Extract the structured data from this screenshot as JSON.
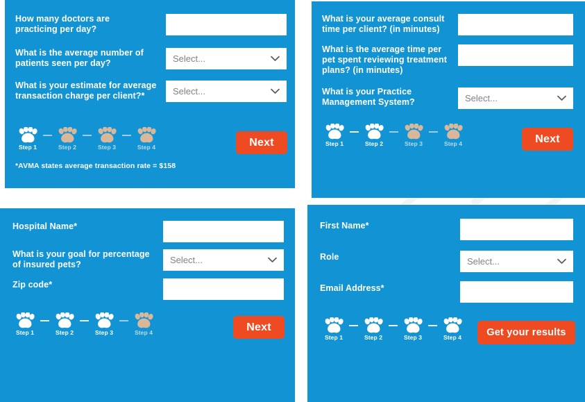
{
  "theme": {
    "panel_blue": "#1193d4",
    "accent_orange": "#ef4b23",
    "label_white": "#ffffff",
    "select_placeholder_grey": "#808285",
    "inactive_step_grey": "#bdd9e8"
  },
  "select_placeholder": "Select...",
  "panels": [
    {
      "id": "step-1-practice-metrics",
      "fields": [
        {
          "name": "doctors-per-day",
          "label": "How many doctors are practicing per day?",
          "control": "text"
        },
        {
          "name": "patients-per-day",
          "label": "What is the average number of patients seen per day?",
          "control": "select",
          "value": "Select..."
        },
        {
          "name": "transaction-charge",
          "label": "What is your estimate for average transaction charge per client?*",
          "control": "select",
          "value": "Select..."
        }
      ],
      "stepper": {
        "steps": [
          {
            "label": "Step 1",
            "active": true
          },
          {
            "label": "Step 2",
            "active": false
          },
          {
            "label": "Step 3",
            "active": false
          },
          {
            "label": "Step 4",
            "active": false
          }
        ]
      },
      "button": {
        "name": "next-button",
        "label": "Next"
      },
      "footnote": "*AVMA states average transaction rate = $158"
    },
    {
      "id": "step-2-time-metrics",
      "fields": [
        {
          "name": "consult-time",
          "label": "What is your average consult time per client? (in minutes)",
          "control": "text"
        },
        {
          "name": "treatment-plan-time",
          "label": "What is the average time per pet spent reviewing treatment plans? (in minutes)",
          "control": "text"
        },
        {
          "name": "practice-management-system",
          "label": "What is your Practice Management System?",
          "control": "select",
          "value": "Select..."
        }
      ],
      "stepper": {
        "steps": [
          {
            "label": "Step 1",
            "active": true
          },
          {
            "label": "Step 2",
            "active": true
          },
          {
            "label": "Step 3",
            "active": false
          },
          {
            "label": "Step 4",
            "active": false
          }
        ]
      },
      "button": {
        "name": "next-button",
        "label": "Next"
      },
      "footnote": ""
    },
    {
      "id": "step-3-hospital-info",
      "fields": [
        {
          "name": "hospital-name",
          "label": "Hospital Name*",
          "control": "text"
        },
        {
          "name": "insured-pets-goal",
          "label": "What is your goal for percentage of insured pets?",
          "control": "select",
          "value": "Select..."
        },
        {
          "name": "zip-code",
          "label": "Zip code*",
          "control": "text"
        }
      ],
      "stepper": {
        "steps": [
          {
            "label": "Step 1",
            "active": true
          },
          {
            "label": "Step 2",
            "active": true
          },
          {
            "label": "Step 3",
            "active": true
          },
          {
            "label": "Step 4",
            "active": false
          }
        ]
      },
      "button": {
        "name": "next-button",
        "label": "Next"
      },
      "footnote": ""
    },
    {
      "id": "step-4-contact-info",
      "fields": [
        {
          "name": "first-name",
          "label": "First Name*",
          "control": "text"
        },
        {
          "name": "role",
          "label": "Role",
          "control": "select",
          "value": "Select..."
        },
        {
          "name": "email-address",
          "label": "Email Address*",
          "control": "text"
        }
      ],
      "stepper": {
        "steps": [
          {
            "label": "Step 1",
            "active": true
          },
          {
            "label": "Step 2",
            "active": true
          },
          {
            "label": "Step 3",
            "active": true
          },
          {
            "label": "Step 4",
            "active": true
          }
        ]
      },
      "button": {
        "name": "get-your-results-button",
        "label": "Get your results"
      },
      "footnote": ""
    }
  ]
}
